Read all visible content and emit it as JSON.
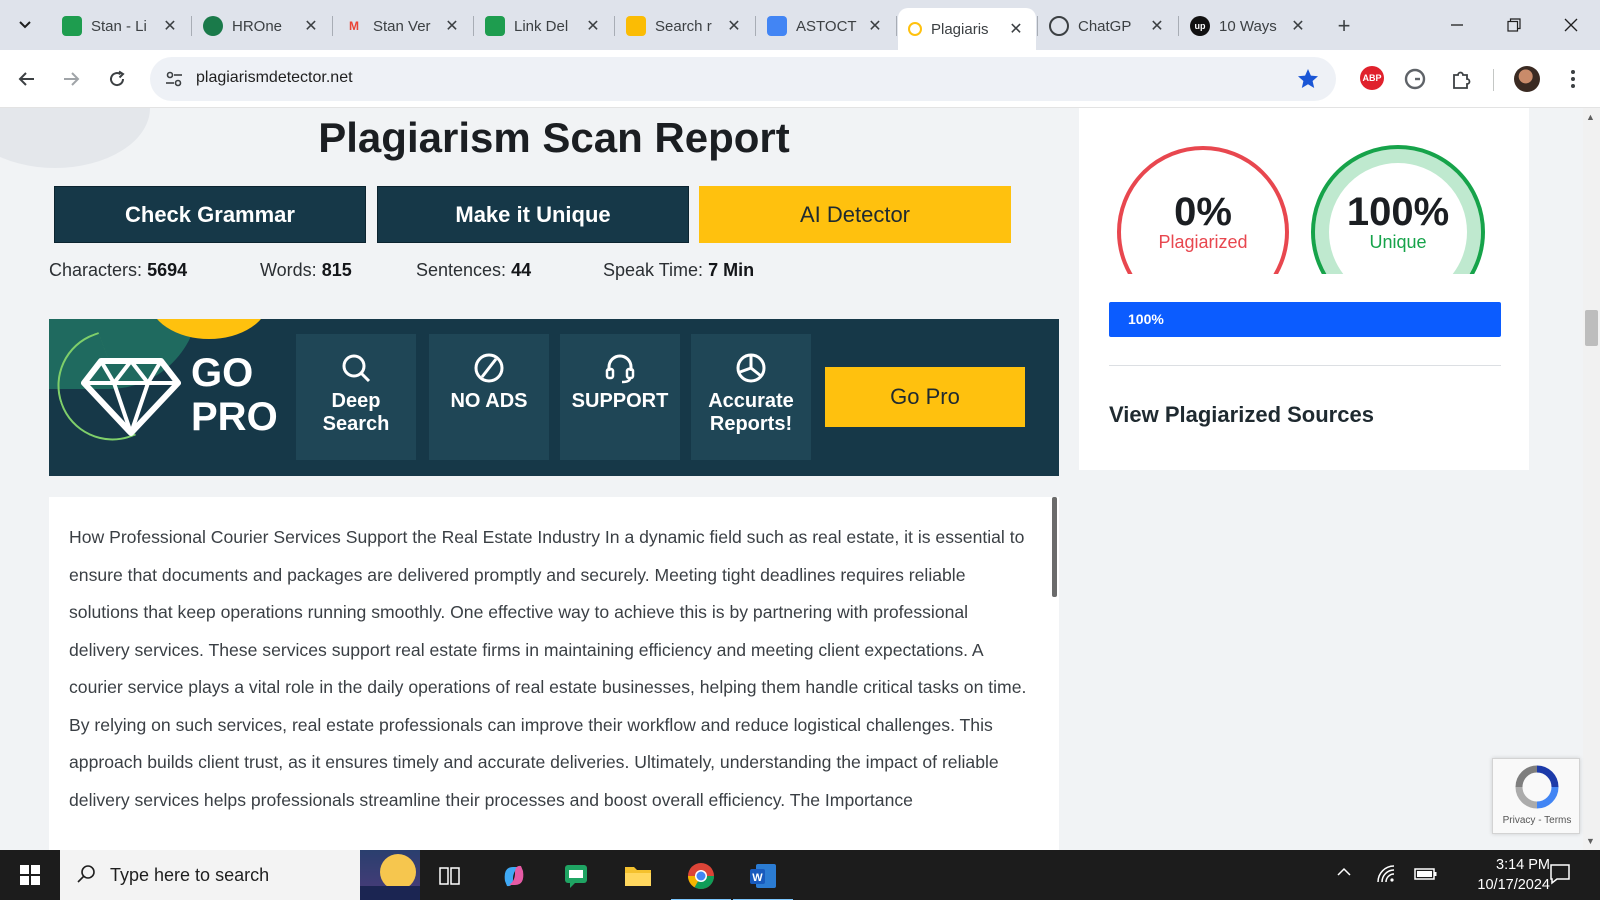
{
  "browser": {
    "tabs": [
      {
        "title": "Stan - Li",
        "favicon": "sheets-icon",
        "color": "#1e9d4f",
        "active": false
      },
      {
        "title": "HROne",
        "favicon": "hrone-icon",
        "color": "#1a7a4a",
        "active": false
      },
      {
        "title": "Stan Ver",
        "favicon": "gmail-icon",
        "color": "#ea4335",
        "active": false
      },
      {
        "title": "Link Del",
        "favicon": "sheets-icon",
        "color": "#1e9d4f",
        "active": false
      },
      {
        "title": "Search r",
        "favicon": "drive-icon",
        "color": "#fbbc04",
        "active": false
      },
      {
        "title": "ASTOCT",
        "favicon": "docs-icon",
        "color": "#4285f4",
        "active": false
      },
      {
        "title": "Plagiaris",
        "favicon": "plagiarism-icon",
        "color": "#ffc10e",
        "active": true
      },
      {
        "title": "ChatGP",
        "favicon": "chatgpt-icon",
        "color": "#3c4043",
        "active": false
      },
      {
        "title": "10 Ways",
        "favicon": "upwork-icon",
        "color": "#111111",
        "active": false
      }
    ],
    "url": "plagiarismdetector.net"
  },
  "page": {
    "title": "Plagiarism Scan Report",
    "buttons": {
      "check_grammar": "Check Grammar",
      "make_unique": "Make it Unique",
      "ai_detector": "AI Detector"
    },
    "stats": {
      "characters_label": "Characters:",
      "characters": "5694",
      "words_label": "Words:",
      "words": "815",
      "sentences_label": "Sentences:",
      "sentences": "44",
      "speak_time_label": "Speak Time:",
      "speak_time": "7 Min"
    },
    "gopro": {
      "line1": "GO",
      "line2": "PRO",
      "features": [
        {
          "line1": "Deep",
          "line2": "Search",
          "icon": "search-icon"
        },
        {
          "line1": "NO ADS",
          "line2": "",
          "icon": "no-ads-icon"
        },
        {
          "line1": "SUPPORT",
          "line2": "",
          "icon": "headset-icon"
        },
        {
          "line1": "Accurate",
          "line2": "Reports!",
          "icon": "pie-chart-icon"
        }
      ],
      "button": "Go Pro"
    },
    "content_text": "How Professional Courier Services Support the Real Estate Industry In a dynamic field such as real estate, it is essential to ensure that documents and packages are delivered promptly and securely. Meeting tight deadlines requires reliable solutions that keep operations running smoothly. One effective way to achieve this is by partnering with professional delivery services. These services support real estate firms in maintaining efficiency and meeting client expectations. A courier service plays a vital role in the daily operations of real estate businesses, helping them handle critical tasks on time. By relying on such services, real estate professionals can improve their workflow and reduce logistical challenges. This approach builds client trust, as it ensures timely and accurate deliveries. Ultimately, understanding the impact of reliable delivery services helps professionals streamline their processes and boost overall efficiency. The Importance"
  },
  "results": {
    "plagiarized_value": "0%",
    "plagiarized_label": "Plagiarized",
    "plagiarized_color": "#e8474f",
    "unique_value": "100%",
    "unique_label": "Unique",
    "unique_color": "#16a34a",
    "progress_label": "100%",
    "progress_fraction": 1.0,
    "progress_color": "#0b5cff",
    "sources_link": "View Plagiarized Sources"
  },
  "recaptcha": {
    "text": "Privacy - Terms"
  },
  "taskbar": {
    "search_placeholder": "Type here to search",
    "time": "3:14 PM",
    "date": "10/17/2024"
  }
}
